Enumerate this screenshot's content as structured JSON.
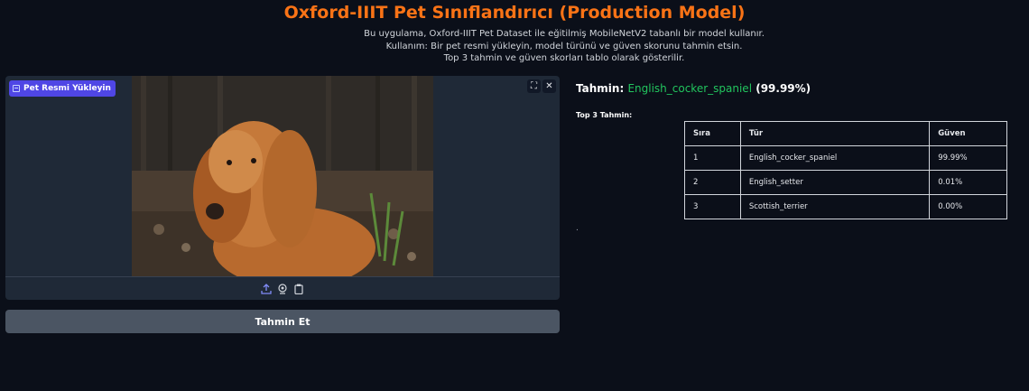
{
  "header": {
    "title": "Oxford-IIIT Pet Sınıflandırıcı (Production Model)",
    "description": [
      "Bu uygulama, Oxford-IIIT Pet Dataset ile eğitilmiş MobileNetV2 tabanlı bir model kullanır.",
      "Kullanım: Bir pet resmi yükleyin, model türünü ve güven skorunu tahmin etsin.",
      "Top 3 tahmin ve güven skorları tablo olarak gösterilir."
    ]
  },
  "upload": {
    "label": "Pet Resmi Yükleyin",
    "image_icon": "image-icon",
    "fullscreen_icon": "fullscreen-icon",
    "close_icon": "close-icon",
    "tools": [
      "upload-icon",
      "webcam-icon",
      "clipboard-icon"
    ]
  },
  "actions": {
    "predict_label": "Tahmin Et"
  },
  "result": {
    "prefix": "Tahmin:",
    "class_name": "English_cocker_spaniel",
    "confidence": "(99.99%)"
  },
  "top3": {
    "label": "Top 3 Tahmin:",
    "headers": [
      "Sıra",
      "Tür",
      "Güven"
    ],
    "rows": [
      [
        "1",
        "English_cocker_spaniel",
        "99.99%"
      ],
      [
        "2",
        "English_setter",
        "0.01%"
      ],
      [
        "3",
        "Scottish_terrier",
        "0.00%"
      ]
    ]
  },
  "footer_mark": ".",
  "colors": {
    "background": "#0b0f19",
    "title": "#f97316",
    "accent": "#4f46e5",
    "class_name": "#22c55e",
    "button": "#4b5563"
  }
}
